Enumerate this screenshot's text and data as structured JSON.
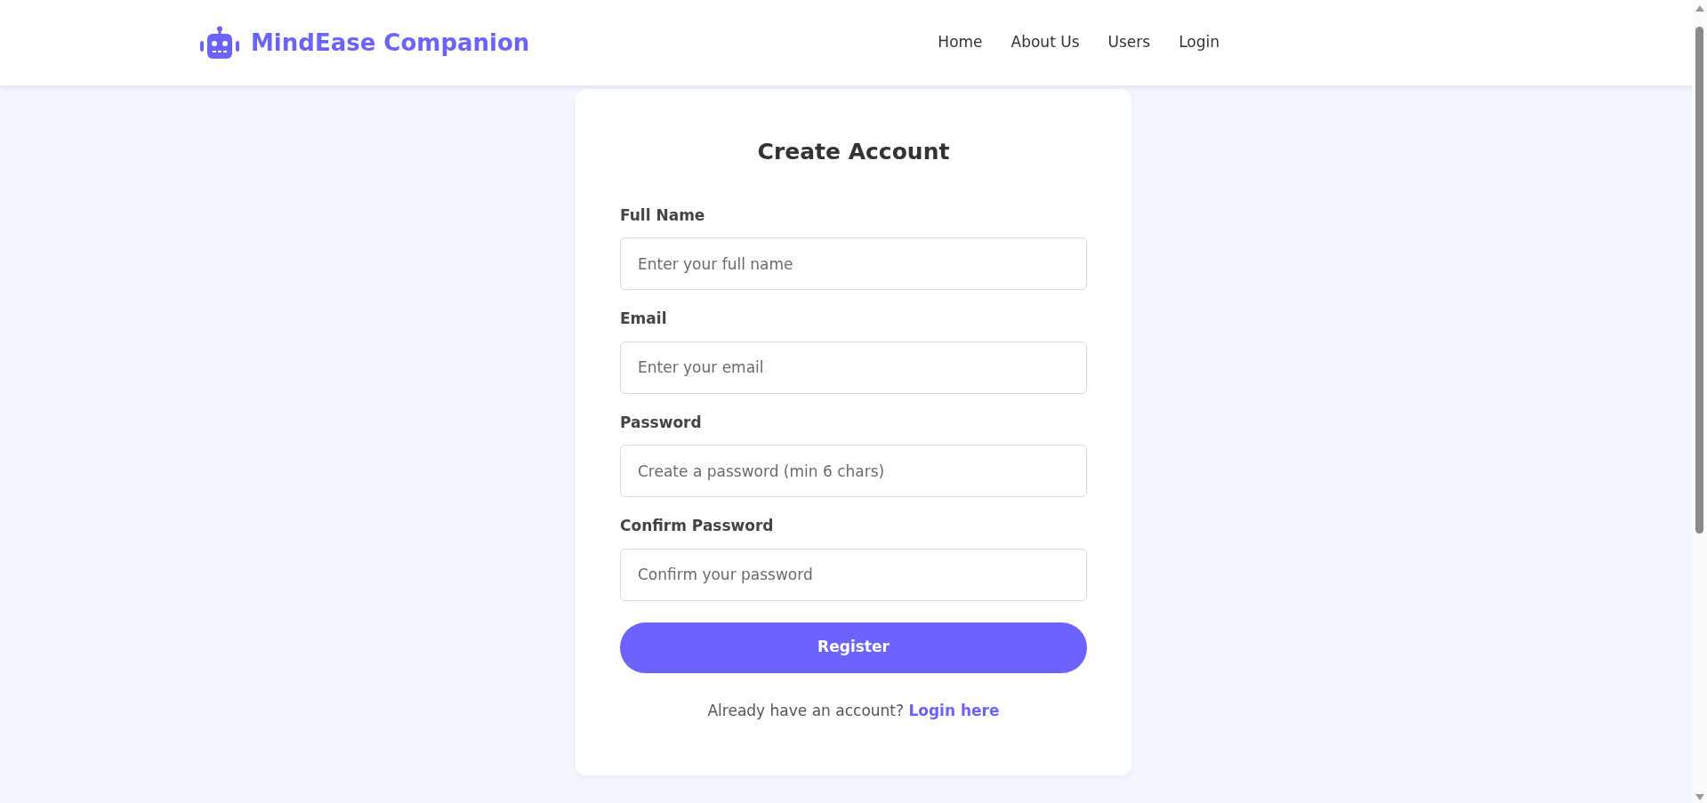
{
  "brand": {
    "name": "MindEase Companion"
  },
  "nav": [
    {
      "label": "Home"
    },
    {
      "label": "About Us"
    },
    {
      "label": "Users"
    },
    {
      "label": "Login"
    }
  ],
  "form": {
    "title": "Create Account",
    "fields": [
      {
        "label": "Full Name",
        "placeholder": "Enter your full name"
      },
      {
        "label": "Email",
        "placeholder": "Enter your email"
      },
      {
        "label": "Password",
        "placeholder": "Create a password (min 6 chars)"
      },
      {
        "label": "Confirm Password",
        "placeholder": "Confirm your password"
      }
    ],
    "submit": "Register",
    "footer": {
      "text": "Already have an account?",
      "link": "Login here"
    }
  }
}
